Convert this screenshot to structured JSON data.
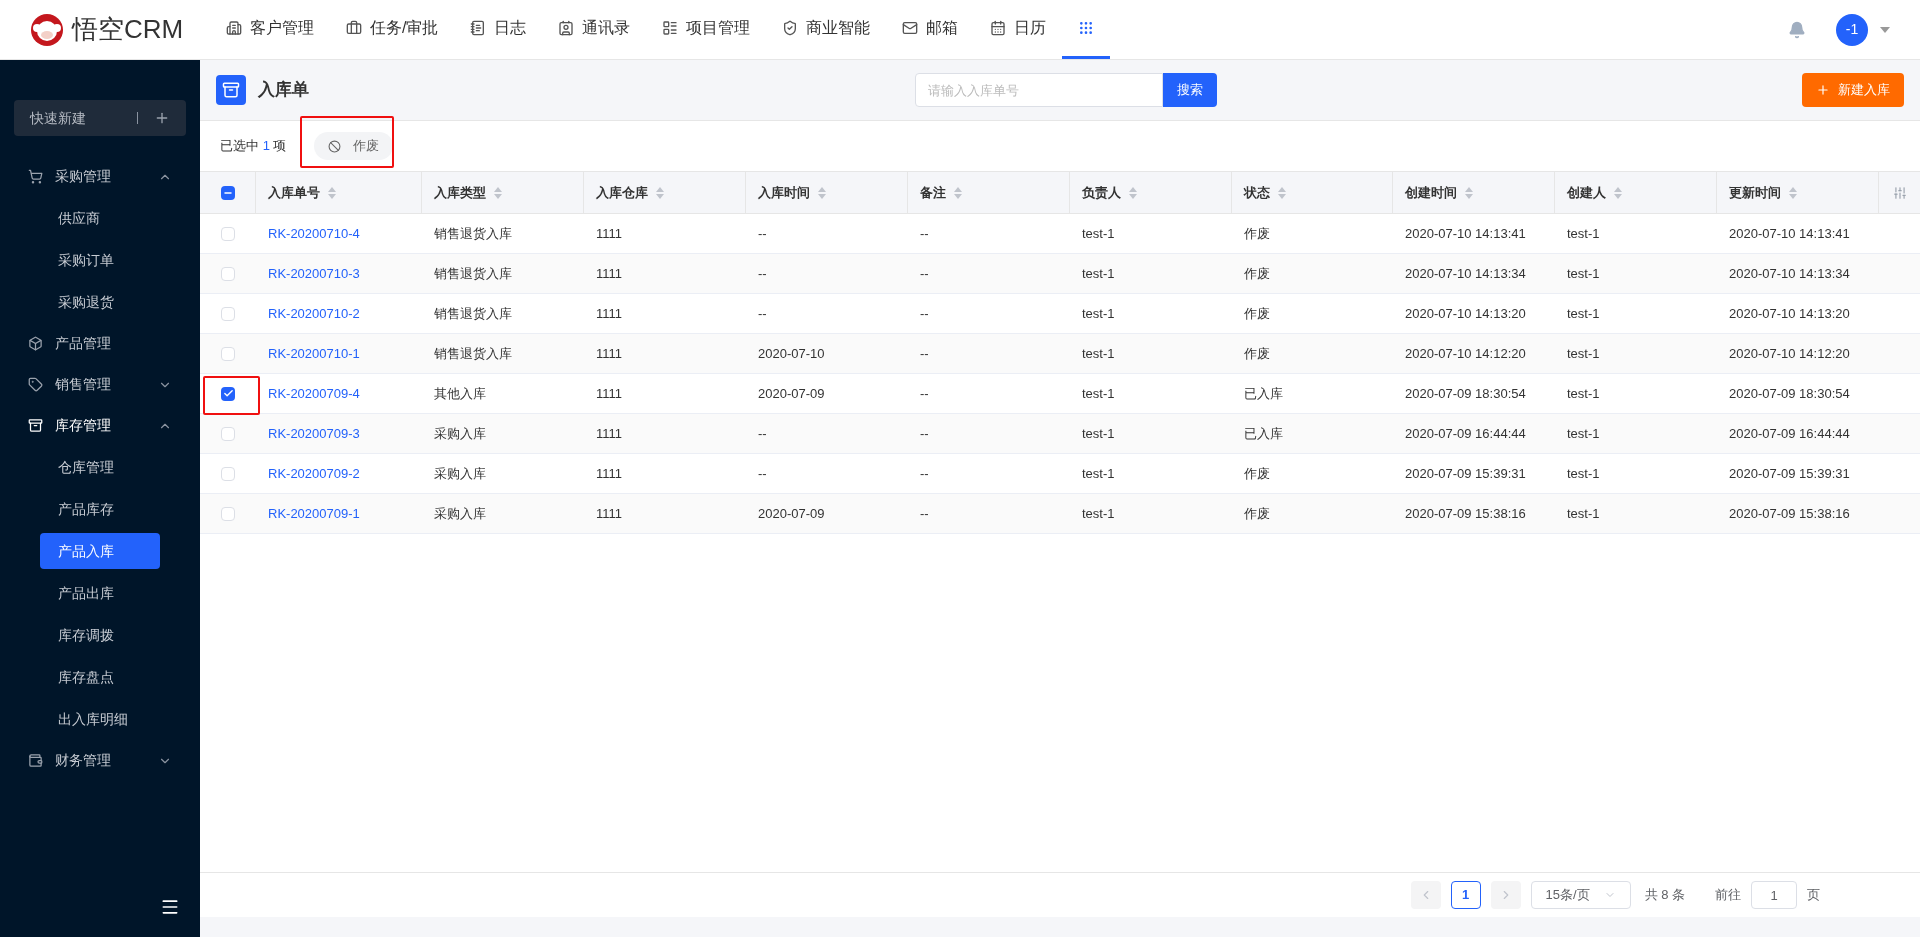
{
  "app": {
    "logo_text": "悟空CRM"
  },
  "nav": [
    {
      "label": "客户管理",
      "selected": false
    },
    {
      "label": "任务/审批",
      "selected": false
    },
    {
      "label": "日志",
      "selected": false
    },
    {
      "label": "通讯录",
      "selected": false
    },
    {
      "label": "项目管理",
      "selected": false
    },
    {
      "label": "商业智能",
      "selected": false
    },
    {
      "label": "邮箱",
      "selected": false
    },
    {
      "label": "日历",
      "selected": false
    },
    {
      "selected": true
    }
  ],
  "user": {
    "avatar_text": "-1"
  },
  "sidebar": {
    "quick_create": "快速新建",
    "groups": [
      {
        "label": "采购管理",
        "expanded": true,
        "children": [
          {
            "label": "供应商",
            "selected": false
          },
          {
            "label": "采购订单",
            "selected": false
          },
          {
            "label": "采购退货",
            "selected": false
          }
        ]
      },
      {
        "label": "产品管理"
      },
      {
        "label": "销售管理",
        "expanded": false
      },
      {
        "label": "库存管理",
        "expanded": true,
        "children": [
          {
            "label": "仓库管理",
            "selected": false
          },
          {
            "label": "产品库存",
            "selected": false
          },
          {
            "label": "产品入库",
            "selected": true
          },
          {
            "label": "产品出库",
            "selected": false
          },
          {
            "label": "库存调拨",
            "selected": false
          },
          {
            "label": "库存盘点",
            "selected": false
          },
          {
            "label": "出入库明细",
            "selected": false
          }
        ]
      },
      {
        "label": "财务管理",
        "expanded": false
      }
    ]
  },
  "page": {
    "title": "入库单",
    "search_placeholder": "请输入入库单号",
    "search_button": "搜索",
    "create_button": "新建入库"
  },
  "selection": {
    "prefix": "已选中",
    "count": "1",
    "suffix": "项",
    "void_button": "作废",
    "void_highlighted": true
  },
  "table": {
    "select_all_partial": true,
    "columns": [
      "入库单号",
      "入库类型",
      "入库仓库",
      "入库时间",
      "备注",
      "负责人",
      "状态",
      "创建时间",
      "创建人",
      "更新时间"
    ],
    "rows": [
      {
        "selected": false,
        "highlighted": false,
        "cells": [
          "RK-20200710-4",
          "销售退货入库",
          "1111",
          "--",
          "--",
          "test-1",
          "作废",
          "2020-07-10 14:13:41",
          "test-1",
          "2020-07-10 14:13:41"
        ]
      },
      {
        "selected": false,
        "highlighted": false,
        "cells": [
          "RK-20200710-3",
          "销售退货入库",
          "1111",
          "--",
          "--",
          "test-1",
          "作废",
          "2020-07-10 14:13:34",
          "test-1",
          "2020-07-10 14:13:34"
        ]
      },
      {
        "selected": false,
        "highlighted": false,
        "cells": [
          "RK-20200710-2",
          "销售退货入库",
          "1111",
          "--",
          "--",
          "test-1",
          "作废",
          "2020-07-10 14:13:20",
          "test-1",
          "2020-07-10 14:13:20"
        ]
      },
      {
        "selected": false,
        "highlighted": false,
        "cells": [
          "RK-20200710-1",
          "销售退货入库",
          "1111",
          "2020-07-10",
          "--",
          "test-1",
          "作废",
          "2020-07-10 14:12:20",
          "test-1",
          "2020-07-10 14:12:20"
        ]
      },
      {
        "selected": true,
        "highlighted": true,
        "cells": [
          "RK-20200709-4",
          "其他入库",
          "1111",
          "2020-07-09",
          "--",
          "test-1",
          "已入库",
          "2020-07-09 18:30:54",
          "test-1",
          "2020-07-09 18:30:54"
        ]
      },
      {
        "selected": false,
        "highlighted": false,
        "cells": [
          "RK-20200709-3",
          "采购入库",
          "1111",
          "--",
          "--",
          "test-1",
          "已入库",
          "2020-07-09 16:44:44",
          "test-1",
          "2020-07-09 16:44:44"
        ]
      },
      {
        "selected": false,
        "highlighted": false,
        "cells": [
          "RK-20200709-2",
          "采购入库",
          "1111",
          "--",
          "--",
          "test-1",
          "作废",
          "2020-07-09 15:39:31",
          "test-1",
          "2020-07-09 15:39:31"
        ]
      },
      {
        "selected": false,
        "highlighted": false,
        "cells": [
          "RK-20200709-1",
          "采购入库",
          "1111",
          "2020-07-09",
          "--",
          "test-1",
          "作废",
          "2020-07-09 15:38:16",
          "test-1",
          "2020-07-09 15:38:16"
        ]
      }
    ]
  },
  "pagination": {
    "current_page": "1",
    "page_size": "15条/页",
    "total": "共 8 条",
    "goto_label": "前往",
    "goto_value": "1",
    "goto_suffix": "页"
  }
}
